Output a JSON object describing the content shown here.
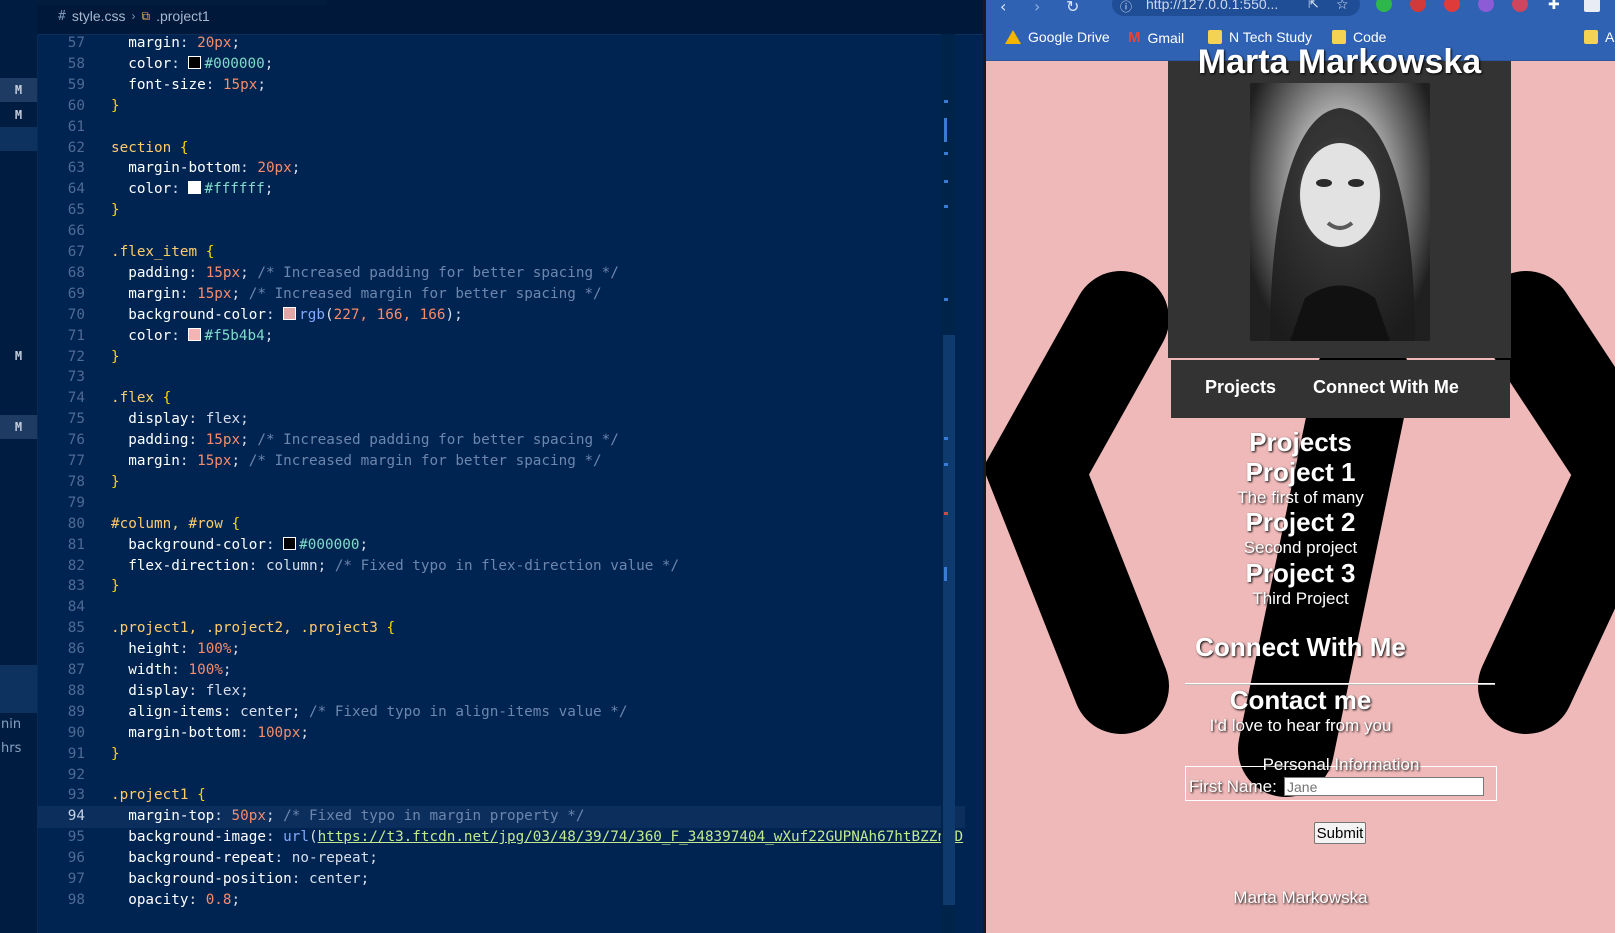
{
  "editor": {
    "breadcrumb": {
      "file": "style.css",
      "symbol": ".project1"
    },
    "side_markers": [
      "M",
      "M",
      "M",
      "M"
    ],
    "side_texts": [
      "nin",
      "hrs"
    ],
    "lines": [
      {
        "n": "57",
        "t": "  margin: 20px;"
      },
      {
        "n": "58",
        "t": "  color: #000000;"
      },
      {
        "n": "59",
        "t": "  font-size: 15px;"
      },
      {
        "n": "60",
        "t": "}"
      },
      {
        "n": "61",
        "t": ""
      },
      {
        "n": "62",
        "t": "section {"
      },
      {
        "n": "63",
        "t": "  margin-bottom: 20px;"
      },
      {
        "n": "64",
        "t": "  color: #ffffff;"
      },
      {
        "n": "65",
        "t": "}"
      },
      {
        "n": "66",
        "t": ""
      },
      {
        "n": "67",
        "t": ".flex_item {"
      },
      {
        "n": "68",
        "t": "  padding: 15px; /* Increased padding for better spacing */"
      },
      {
        "n": "69",
        "t": "  margin: 15px; /* Increased margin for better spacing */"
      },
      {
        "n": "70",
        "t": "  background-color: rgb(227, 166, 166);"
      },
      {
        "n": "71",
        "t": "  color: #f5b4b4;"
      },
      {
        "n": "72",
        "t": "}"
      },
      {
        "n": "73",
        "t": ""
      },
      {
        "n": "74",
        "t": ".flex {"
      },
      {
        "n": "75",
        "t": "  display: flex;"
      },
      {
        "n": "76",
        "t": "  padding: 15px; /* Increased padding for better spacing */"
      },
      {
        "n": "77",
        "t": "  margin: 15px; /* Increased margin for better spacing */"
      },
      {
        "n": "78",
        "t": "}"
      },
      {
        "n": "79",
        "t": ""
      },
      {
        "n": "80",
        "t": "#column, #row {"
      },
      {
        "n": "81",
        "t": "  background-color: #000000;"
      },
      {
        "n": "82",
        "t": "  flex-direction: column; /* Fixed typo in flex-direction value */"
      },
      {
        "n": "83",
        "t": "}"
      },
      {
        "n": "84",
        "t": ""
      },
      {
        "n": "85",
        "t": ".project1, .project2, .project3 {"
      },
      {
        "n": "86",
        "t": "  height: 100%;"
      },
      {
        "n": "87",
        "t": "  width: 100%;"
      },
      {
        "n": "88",
        "t": "  display: flex;"
      },
      {
        "n": "89",
        "t": "  align-items: center; /* Fixed typo in align-items value */"
      },
      {
        "n": "90",
        "t": "  margin-bottom: 100px;"
      },
      {
        "n": "91",
        "t": "}"
      },
      {
        "n": "92",
        "t": ""
      },
      {
        "n": "93",
        "t": ".project1 {"
      },
      {
        "n": "94",
        "t": "  margin-top: 50px; /* Fixed typo in margin property */"
      },
      {
        "n": "95",
        "t": "  background-image: url(\"https://t3.ftcdn.net/jpg/03/48/39/74/360_F_348397404_wXuf22GUPNAh67htBZZnaD"
      },
      {
        "n": "96",
        "t": "  background-repeat: no-repeat;"
      },
      {
        "n": "97",
        "t": "  background-position: center;"
      },
      {
        "n": "98",
        "t": "  opacity: 0.8;"
      }
    ],
    "colors": {
      "background": "#002451",
      "selector": "#ffcb6b",
      "number": "#f78c6c",
      "comment": "#6d86ad"
    }
  },
  "browser": {
    "url": "http://127.0.0.1:550...",
    "bookmarks": [
      "Google Drive",
      "Gmail",
      "N Tech Study",
      "Code",
      "A"
    ],
    "page": {
      "name": "Marta Markowska",
      "nav": [
        "Projects",
        "Connect With Me"
      ],
      "projects_heading": "Projects",
      "projects": [
        {
          "title": "Project 1",
          "desc": "The first of many"
        },
        {
          "title": "Project 2",
          "desc": "Second project"
        },
        {
          "title": "Project 3",
          "desc": "Third Project"
        }
      ],
      "connect_heading": "Connect With Me",
      "contact_heading": "Contact me",
      "contact_sub": "I'd love to hear from you",
      "legend": "Personal Information",
      "first_name_label": "First Name:",
      "first_name_placeholder": "Jane",
      "submit_label": "Submit",
      "footer": "Marta Markowska"
    },
    "colors": {
      "page_bg": "#efb9b9",
      "card_bg": "#333333",
      "chrome": "#2f62b3"
    }
  }
}
